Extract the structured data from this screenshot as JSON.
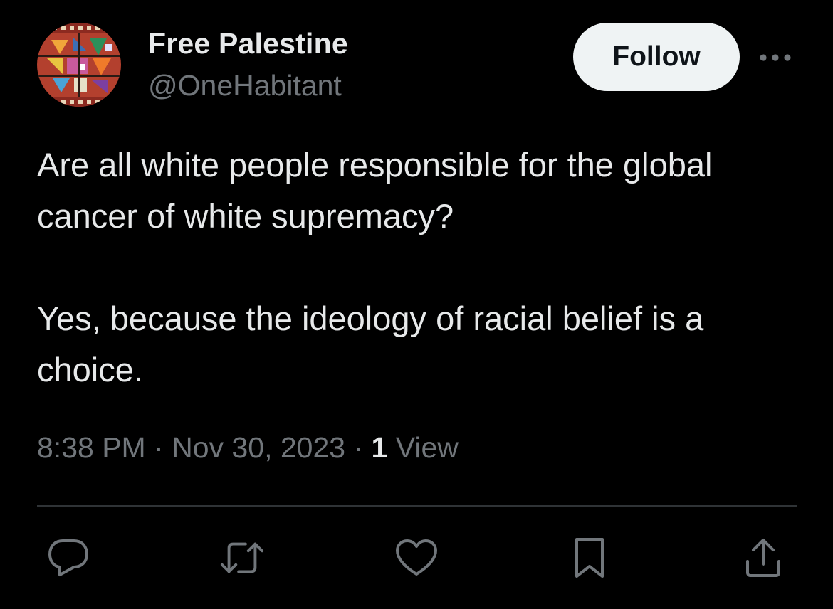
{
  "author": {
    "display_name": "Free Palestine",
    "handle": "@OneHabitant",
    "avatar_icon": "embroidery-pattern-avatar"
  },
  "follow_button": {
    "label": "Follow"
  },
  "more_menu": {
    "icon": "more-horizontal-icon"
  },
  "tweet": {
    "paragraphs": [
      "Are all white people responsible for the global cancer of white supremacy?",
      "Yes, because the ideology of racial belief is a choice."
    ]
  },
  "meta": {
    "time": "8:38 PM",
    "separator": "·",
    "date": "Nov 30, 2023",
    "view_count": "1",
    "view_label": "View"
  },
  "actions": [
    {
      "name": "reply",
      "icon": "reply-icon"
    },
    {
      "name": "retweet",
      "icon": "retweet-icon"
    },
    {
      "name": "like",
      "icon": "heart-icon"
    },
    {
      "name": "bookmark",
      "icon": "bookmark-icon"
    },
    {
      "name": "share",
      "icon": "share-icon"
    }
  ],
  "colors": {
    "background": "#000000",
    "primary_text": "#e7e9ea",
    "secondary_text": "#71767b",
    "divider": "#2f3336",
    "follow_button_bg": "#eff3f4"
  }
}
